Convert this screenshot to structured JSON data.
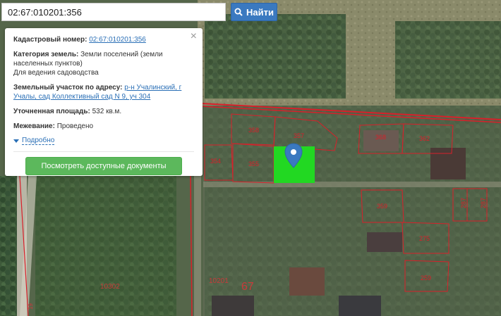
{
  "search": {
    "value": "02:67:010201:356",
    "button_label": "Найти",
    "button_icon": "search-icon"
  },
  "info_card": {
    "close_icon": "close-icon",
    "cadastral_label": "Кадастровый номер:",
    "cadastral_value": "02:67:010201:356",
    "category_label": "Категория земель:",
    "category_value_1": "Земли поселений (земли",
    "category_value_2": "населенных пунктов)",
    "purpose": "Для ведения садоводства",
    "address_label": "Земельный участок по адресу:",
    "address_1": "р-н Учалинский, г",
    "address_2": "Учалы, сад Коллективный сад N 9, уч 304",
    "area_label": "Уточненная площадь:",
    "area_value": "532 кв.м.",
    "survey_label": "Межевание:",
    "survey_value": "Проведено",
    "details_label": "Подробно",
    "docs_button": "Посмотреть доступные документы"
  },
  "map": {
    "parcel_labels": [
      "358",
      "357",
      "368",
      "362",
      "354",
      "355",
      "359",
      "287",
      "287",
      "275",
      "259"
    ],
    "block_labels": [
      "10302",
      "10201",
      "67"
    ],
    "edge_label": "19",
    "colors": {
      "selected_parcel": "#22d822",
      "parcel_outline": "#d8202a",
      "marker": "#3a79c0"
    }
  }
}
